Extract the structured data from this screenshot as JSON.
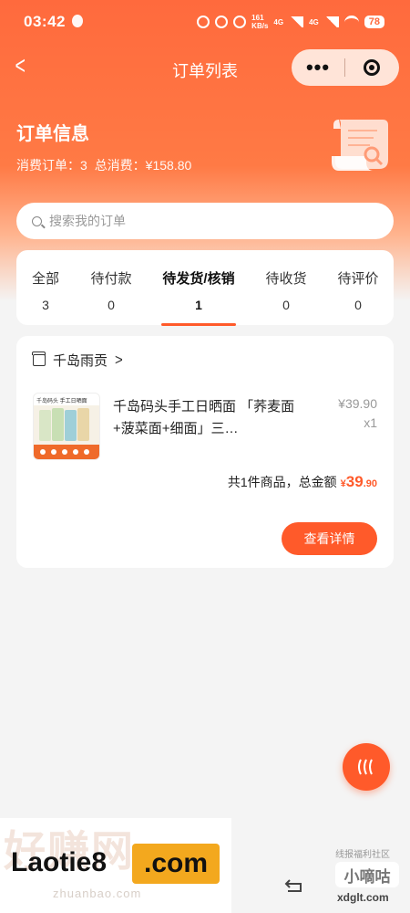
{
  "status_bar": {
    "time": "03:42",
    "net_speed_value": "161",
    "net_speed_unit": "KB/s",
    "signal1": "4G",
    "signal2": "4G",
    "battery": "78"
  },
  "navbar": {
    "back_icon": "chevron-left-icon",
    "title": "订单列表",
    "more_icon": "more-dots-icon",
    "close_icon": "target-icon"
  },
  "summary": {
    "title": "订单信息",
    "order_label": "消费订单：3",
    "total_label": "总消费：¥158.80"
  },
  "search": {
    "placeholder": "搜索我的订单"
  },
  "tabs": [
    {
      "label": "全部",
      "count": "3"
    },
    {
      "label": "待付款",
      "count": "0"
    },
    {
      "label": "待发货/核销",
      "count": "1"
    },
    {
      "label": "待收货",
      "count": "0"
    },
    {
      "label": "待评价",
      "count": "0"
    }
  ],
  "order": {
    "shop_name": "千岛雨贡",
    "product_name": "千岛码头手工日晒面 「荞麦面+菠菜面+细面」三…",
    "price": "¥39.90",
    "quantity": "x1",
    "total_prefix": "共1件商品，总金额",
    "total_currency": "¥",
    "total_int": "39",
    "total_dec": ".90",
    "detail_button": "查看详情",
    "thumb_text": "千岛码头 手工日晒面"
  },
  "watermarks": {
    "big": "好赚网",
    "laotie": "Laotie8",
    "com": ".com",
    "site": "zhuanbao.com",
    "forum_tag": "线报福利社区",
    "forum_name": "小嘀咕",
    "forum_domain": "xdglt.com"
  },
  "colors": {
    "accent": "#ff5a2a",
    "header_gradient_top": "#ff6a3d"
  }
}
